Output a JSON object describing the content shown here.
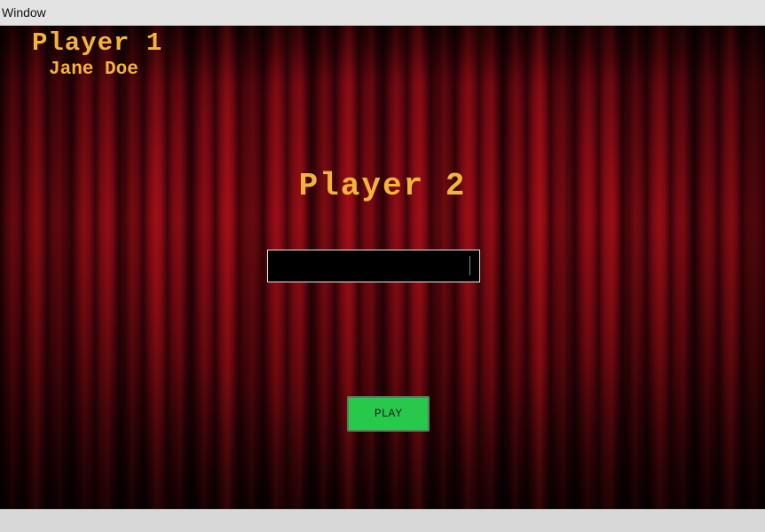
{
  "window": {
    "title": "Window"
  },
  "player1": {
    "heading": "Player 1",
    "name": "Jane Doe"
  },
  "player2": {
    "heading": "Player 2",
    "name_input_value": ""
  },
  "actions": {
    "play_label": "PLAY"
  },
  "colors": {
    "heading_gold": "#f2b43c",
    "curtain_red": "#8a0a14",
    "play_button_green": "#28c84a",
    "input_background": "#000000"
  }
}
